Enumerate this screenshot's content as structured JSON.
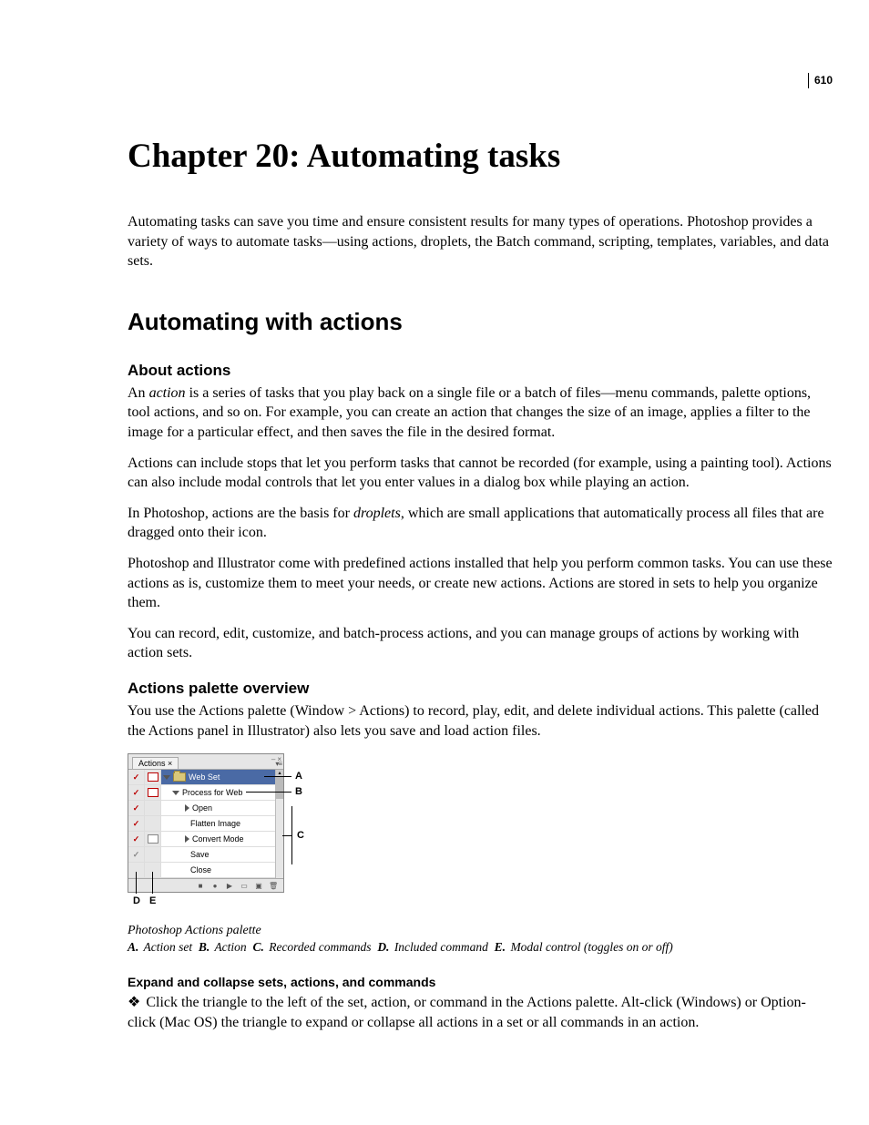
{
  "page_number": "610",
  "chapter_title": "Chapter 20: Automating tasks",
  "intro": "Automating tasks can save you time and ensure consistent results for many types of operations. Photoshop provides a variety of ways to automate tasks—using actions, droplets, the Batch command, scripting, templates, variables, and data sets.",
  "section_title": "Automating with actions",
  "about_heading": "About actions",
  "about_p1_pre": "An ",
  "about_p1_em": "action",
  "about_p1_post": " is a series of tasks that you play back on a single file or a batch of files—menu commands, palette options, tool actions, and so on. For example, you can create an action that changes the size of an image, applies a filter to the image for a particular effect, and then saves the file in the desired format.",
  "about_p2": "Actions can include stops that let you perform tasks that cannot be recorded (for example, using a painting tool). Actions can also include modal controls that let you enter values in a dialog box while playing an action.",
  "about_p3_pre": "In Photoshop, actions are the basis for ",
  "about_p3_em": "droplets",
  "about_p3_post": ", which are small applications that automatically process all files that are dragged onto their icon.",
  "about_p4": "Photoshop and Illustrator come with predefined actions installed that help you perform common tasks. You can use these actions as is, customize them to meet your needs, or create new actions. Actions are stored in sets to help you organize them.",
  "about_p5": "You can record, edit, customize, and batch-process actions, and you can manage groups of actions by working with action sets.",
  "overview_heading": "Actions palette overview",
  "overview_p1": "You use the Actions palette (Window > Actions) to record, play, edit, and delete individual actions. This palette (called the Actions panel in Illustrator) also lets you save and load action files.",
  "palette": {
    "tab": "Actions ×",
    "set": "Web Set",
    "action": "Process for Web",
    "cmd1": "Open",
    "cmd2": "Flatten Image",
    "cmd3": "Convert Mode",
    "cmd4": "Save",
    "cmd5": "Close"
  },
  "callout_A": "A",
  "callout_B": "B",
  "callout_C": "C",
  "callout_D": "D",
  "callout_E": "E",
  "caption": "Photoshop Actions palette",
  "legend_A_key": "A.",
  "legend_A_val": "Action set",
  "legend_B_key": "B.",
  "legend_B_val": "Action",
  "legend_C_key": "C.",
  "legend_C_val": "Recorded commands",
  "legend_D_key": "D.",
  "legend_D_val": "Included command",
  "legend_E_key": "E.",
  "legend_E_val": "Modal control (toggles on or off)",
  "expand_heading": "Expand and collapse sets, actions, and commands",
  "expand_bullet": "Click the triangle to the left of the set, action, or command in the Actions palette. Alt-click (Windows) or Option-click (Mac OS) the triangle to expand or collapse all actions in a set or all commands in an action."
}
